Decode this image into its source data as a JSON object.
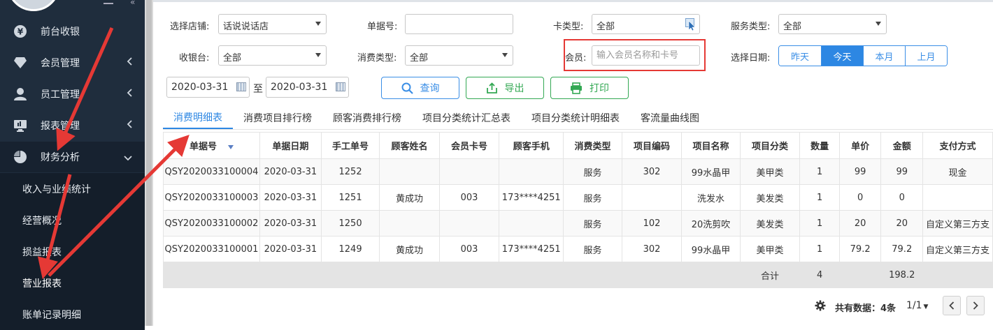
{
  "sidebar": {
    "items": [
      {
        "label": "前台收银",
        "icon": "yen-coin-icon",
        "has_caret": false
      },
      {
        "label": "会员管理",
        "icon": "diamond-icon",
        "has_caret": true
      },
      {
        "label": "员工管理",
        "icon": "user-icon",
        "has_caret": true
      },
      {
        "label": "报表管理",
        "icon": "monitor-icon",
        "has_caret": true
      },
      {
        "label": "财务分析",
        "icon": "pie-chart-icon",
        "has_caret": true
      }
    ],
    "sub_items": [
      "收入与业绩统计",
      "经营概况",
      "损益报表",
      "营业报表",
      "账单记录明细"
    ]
  },
  "filters": {
    "store_label": "选择店铺:",
    "store_value": "话说说话店",
    "doc_no_label": "单据号:",
    "doc_no_value": "",
    "card_type_label": "卡类型:",
    "card_type_value": "全部",
    "service_type_label": "服务类型:",
    "service_type_value": "全部",
    "cashier_label": "收银台:",
    "cashier_value": "全部",
    "consume_type_label": "消费类型:",
    "consume_type_value": "全部",
    "member_label": "会员:",
    "member_placeholder": "输入会员名称和卡号",
    "date_label": "选择日期:",
    "date_segments": [
      "昨天",
      "今天",
      "本月",
      "上月"
    ],
    "date_active": "今天",
    "date_from": "2020-03-31",
    "date_to_sep": "至",
    "date_to": "2020-03-31"
  },
  "actions": {
    "query": "查询",
    "export": "导出",
    "print": "打印"
  },
  "tabs": [
    "消费明细表",
    "消费项目排行榜",
    "顾客消费排行榜",
    "项目分类统计汇总表",
    "项目分类统计明细表",
    "客流量曲线图"
  ],
  "table": {
    "columns": [
      "单据号",
      "单据日期",
      "手工单号",
      "顾客姓名",
      "会员卡号",
      "顾客手机",
      "消费类型",
      "项目编码",
      "项目名称",
      "项目分类",
      "数量",
      "单价",
      "金额",
      "支付方式"
    ],
    "rows": [
      [
        "QSY2020033100004",
        "2020-03-31",
        "1252",
        "",
        "",
        "",
        "服务",
        "302",
        "99水晶甲",
        "美甲类",
        "1",
        "99",
        "99",
        "现金"
      ],
      [
        "QSY2020033100003",
        "2020-03-31",
        "1251",
        "黄成功",
        "003",
        "173****4251",
        "服务",
        "",
        "洗发水",
        "美发类",
        "1",
        "0",
        "0",
        ""
      ],
      [
        "QSY2020033100002",
        "2020-03-31",
        "1250",
        "",
        "",
        "",
        "服务",
        "102",
        "20洗剪吹",
        "美发类",
        "1",
        "20",
        "20",
        "自定义第三方支"
      ],
      [
        "QSY2020033100001",
        "2020-03-31",
        "1249",
        "黄成功",
        "003",
        "173****4251",
        "服务",
        "302",
        "99水晶甲",
        "美甲类",
        "1",
        "79.2",
        "79.2",
        "自定义第三方支"
      ]
    ],
    "total": {
      "label": "合计",
      "qty": "4",
      "amount": "198.2"
    }
  },
  "pagination": {
    "total_text": "共有数据：4条",
    "page": "1/1"
  },
  "colors": {
    "sidebar_bg": "#1f2d3d",
    "accent_blue": "#2d87e3",
    "accent_green": "#33a853",
    "annotation_red": "#e53935"
  }
}
